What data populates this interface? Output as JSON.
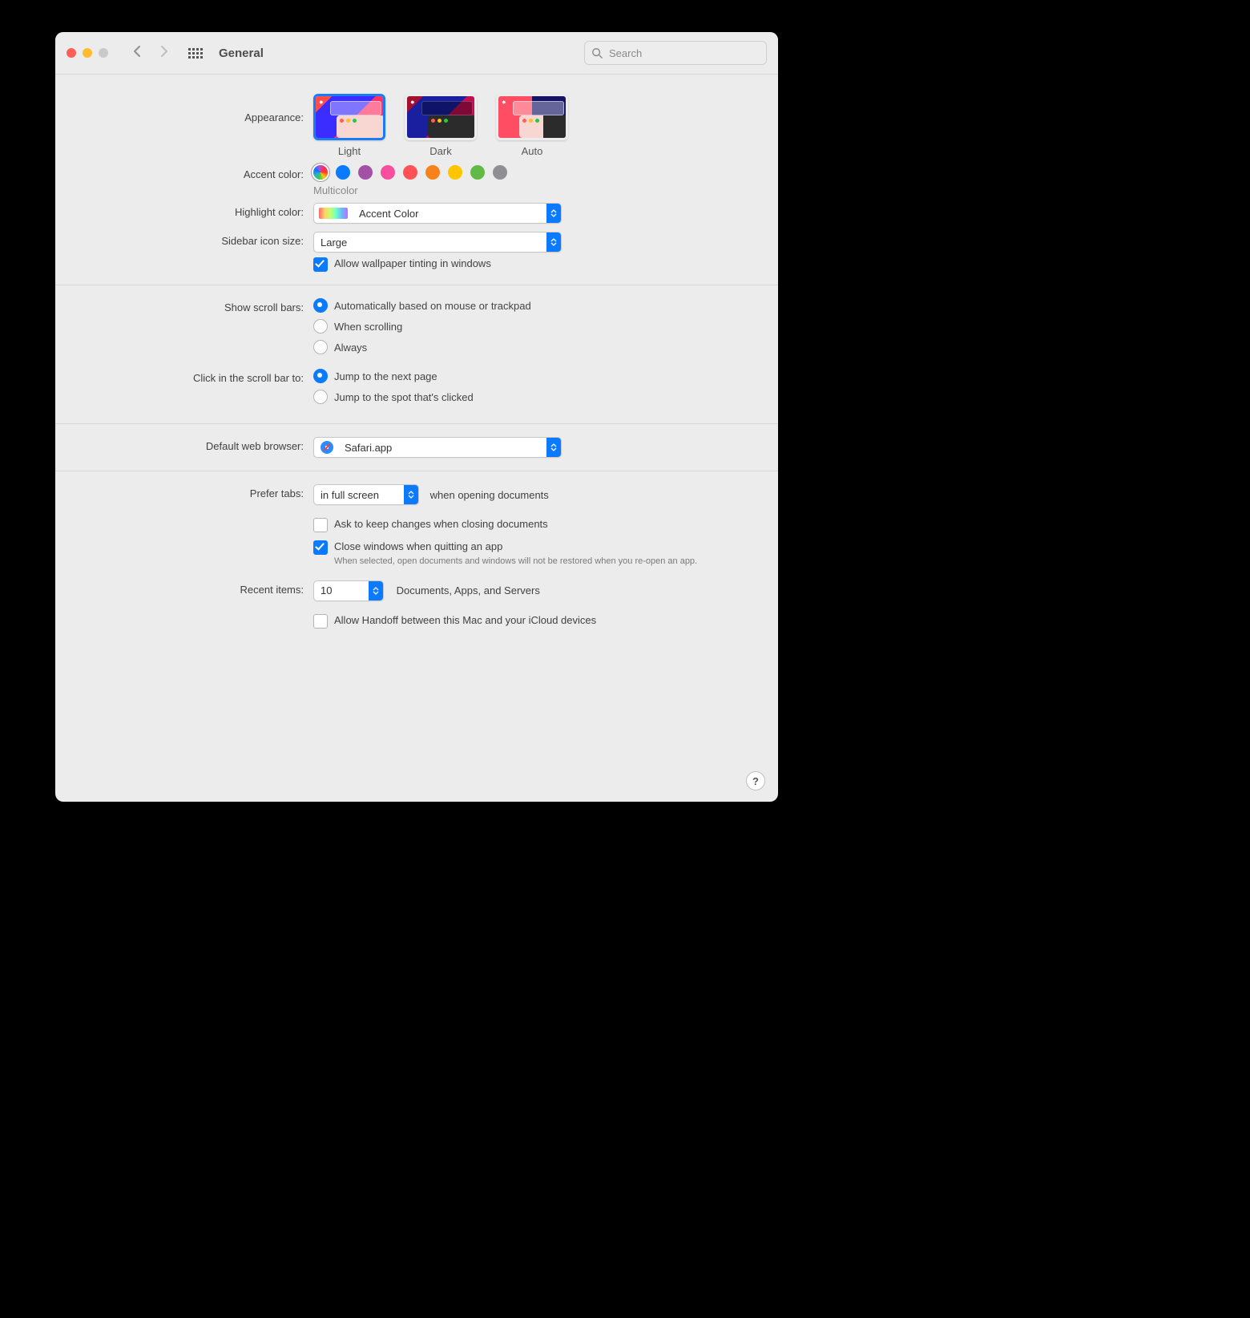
{
  "window": {
    "title": "General"
  },
  "search": {
    "placeholder": "Search"
  },
  "labels": {
    "appearance": "Appearance:",
    "accent": "Accent color:",
    "highlight": "Highlight color:",
    "sidebar": "Sidebar icon size:",
    "scrollbars": "Show scroll bars:",
    "scrollclick": "Click in the scroll bar to:",
    "browser": "Default web browser:",
    "prefertabs": "Prefer tabs:",
    "recent": "Recent items:"
  },
  "appearance": {
    "options": {
      "light": "Light",
      "dark": "Dark",
      "auto": "Auto"
    },
    "selected": "light"
  },
  "accent": {
    "options": [
      "Multicolor",
      "Blue",
      "Purple",
      "Pink",
      "Red",
      "Orange",
      "Yellow",
      "Green",
      "Graphite"
    ],
    "selected": "Multicolor",
    "caption": "Multicolor"
  },
  "highlight": {
    "value": "Accent Color"
  },
  "sidebar": {
    "value": "Large"
  },
  "wallpaper_tint": {
    "label": "Allow wallpaper tinting in windows",
    "checked": true
  },
  "scrollbars": {
    "options": {
      "auto": "Automatically based on mouse or trackpad",
      "scrolling": "When scrolling",
      "always": "Always"
    },
    "selected": "auto"
  },
  "scrollclick": {
    "options": {
      "page": "Jump to the next page",
      "spot": "Jump to the spot that's clicked"
    },
    "selected": "page"
  },
  "browser": {
    "value": "Safari.app"
  },
  "prefertabs": {
    "value": "in full screen",
    "suffix": "when opening documents"
  },
  "ask_keep_changes": {
    "label": "Ask to keep changes when closing documents",
    "checked": false
  },
  "close_on_quit": {
    "label": "Close windows when quitting an app",
    "checked": true,
    "hint": "When selected, open documents and windows will not be restored when you re-open an app."
  },
  "recent": {
    "value": "10",
    "suffix": "Documents, Apps, and Servers"
  },
  "handoff": {
    "label": "Allow Handoff between this Mac and your iCloud devices",
    "checked": false
  },
  "help": "?"
}
